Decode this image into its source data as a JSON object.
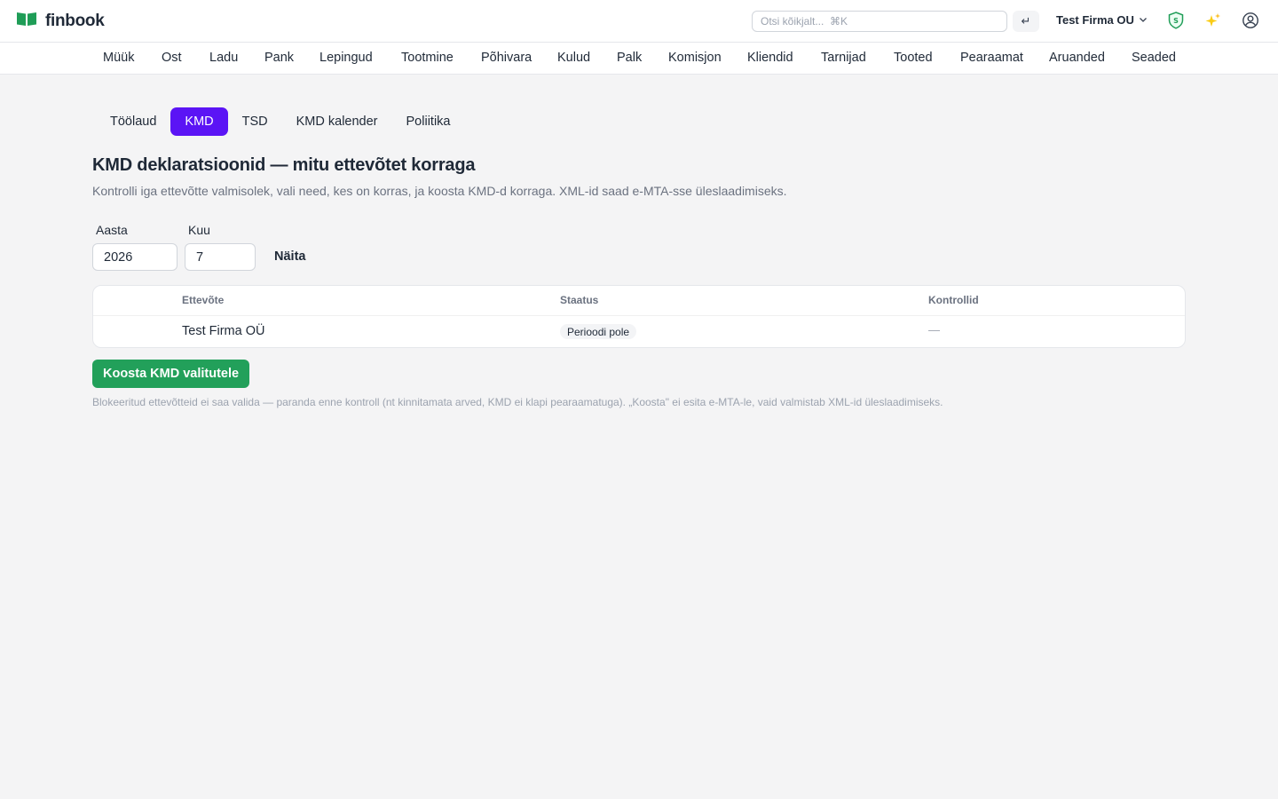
{
  "app": {
    "name": "finbook"
  },
  "header": {
    "search_placeholder": "Otsi kõikjalt...  ⌘K",
    "enter_label": "↵",
    "company_name": "Test Firma OU",
    "shield_letter": "S"
  },
  "nav": {
    "items": [
      "Müük",
      "Ost",
      "Ladu",
      "Pank",
      "Lepingud",
      "Tootmine",
      "Põhivara",
      "Kulud",
      "Palk",
      "Komisjon",
      "Kliendid",
      "Tarnijad",
      "Tooted",
      "Pearaamat",
      "Aruanded",
      "Seaded"
    ]
  },
  "tabs": {
    "items": [
      "Töölaud",
      "KMD",
      "TSD",
      "KMD kalender",
      "Poliitika"
    ],
    "active": "KMD"
  },
  "page": {
    "title": "KMD deklaratsioonid — mitu ettevõtet korraga",
    "subtitle": "Kontrolli iga ettevõtte valmisolek, vali need, kes on korras, ja koosta KMD-d korraga. XML-id saad e-MTA-sse üleslaadimiseks."
  },
  "filters": {
    "year_label": "Aasta",
    "year_value": "2026",
    "month_label": "Kuu",
    "month_value": "7",
    "show_label": "Näita"
  },
  "table": {
    "headers": [
      "Ettevõte",
      "Staatus",
      "Kontrollid"
    ],
    "rows": [
      {
        "company": "Test Firma OÜ",
        "status": "Perioodi pole",
        "checks": "—"
      }
    ]
  },
  "actions": {
    "compose_label": "Koosta KMD valitutele",
    "note": "Blokeeritud ettevõtteid ei saa valida — paranda enne kontroll (nt kinnitamata arved, KMD ei klapi pearaamatuga). „Koosta\" ei esita e-MTA-le, vaid valmistab XML-id üleslaadimiseks."
  },
  "colors": {
    "brand_green": "#1f9d57",
    "accent_purple": "#5b14f5",
    "primary_button": "#22a05a"
  },
  "icons": {
    "logo": "open-book-icon",
    "enter": "enter-key-icon",
    "chevron": "chevron-down-icon",
    "shield": "shield-icon",
    "sparkles": "sparkles-icon",
    "user": "user-circle-icon"
  }
}
